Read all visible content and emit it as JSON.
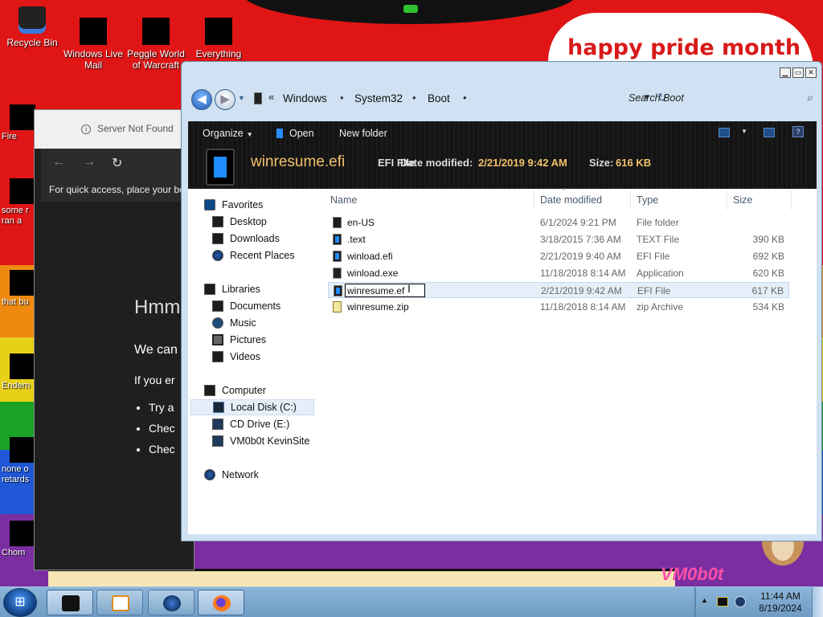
{
  "wallpaper": {
    "banner_text": "happy pride month",
    "corner_text": "VM0b0t"
  },
  "desktop_icons": [
    {
      "label": "Recycle Bin",
      "icon": "recycle-bin-icon"
    },
    {
      "label": "Windows Live Mail",
      "icon": "mail-icon"
    },
    {
      "label": "Peggle World of Warcraft",
      "icon": "game-icon"
    },
    {
      "label": "Everything",
      "icon": "search-icon"
    }
  ],
  "side_tiles": [
    {
      "label": "Fire",
      "icon": "firefox-icon"
    },
    {
      "label": "some r ran a",
      "icon": "app-icon"
    },
    {
      "label": "that bu",
      "icon": "app-icon"
    },
    {
      "label": "Endern",
      "icon": "app-icon"
    },
    {
      "label": "none o retards",
      "icon": "app-icon"
    },
    {
      "label": "Chom",
      "icon": "app-icon"
    }
  ],
  "browser": {
    "tab_text": "Server Not Found",
    "quick_access": "For quick access, place your bo",
    "heading": "Hmm",
    "line1": "We can",
    "line2": "If you er",
    "bullets": [
      "Try a",
      "Chec",
      "Chec"
    ]
  },
  "explorer": {
    "breadcrumb": [
      "Windows",
      "System32",
      "Boot"
    ],
    "search_placeholder": "Search Boot",
    "toolbar": {
      "organize": "Organize",
      "open": "Open",
      "new_folder": "New folder"
    },
    "details": {
      "name": "winresume.efi",
      "type": "EFI File",
      "modified_label": "Date modified:",
      "modified_value": "2/21/2019 9:42 AM",
      "size_label": "Size:",
      "size_value": "616 KB"
    },
    "nav": {
      "favorites": "Favorites",
      "favorites_items": [
        "Desktop",
        "Downloads",
        "Recent Places"
      ],
      "libraries": "Libraries",
      "libraries_items": [
        "Documents",
        "Music",
        "Pictures",
        "Videos"
      ],
      "computer": "Computer",
      "computer_items": [
        "Local Disk (C:)",
        "CD Drive (E:)",
        "VM0b0t KevinSite"
      ],
      "network": "Network"
    },
    "columns": [
      "Name",
      "Date modified",
      "Type",
      "Size"
    ],
    "files": [
      {
        "name": "en-US",
        "date": "6/1/2024 9:21 PM",
        "type": "File folder",
        "size": ""
      },
      {
        "name": ".text",
        "date": "3/18/2015 7:36 AM",
        "type": "TEXT File",
        "size": "390 KB"
      },
      {
        "name": "winload.efi",
        "date": "2/21/2019 9:40 AM",
        "type": "EFI File",
        "size": "692 KB"
      },
      {
        "name": "winload.exe",
        "date": "11/18/2018 8:14 AM",
        "type": "Application",
        "size": "620 KB"
      },
      {
        "name": "winresume.ef",
        "date": "2/21/2019 9:42 AM",
        "type": "EFI File",
        "size": "617 KB"
      },
      {
        "name": "winresume.zip",
        "date": "11/18/2018 8:14 AM",
        "type": "zip Archive",
        "size": "534 KB"
      }
    ],
    "rename_value": "winresume.ef"
  },
  "taskbar": {
    "apps": [
      "explorer-icon",
      "media-player-icon",
      "globe-icon",
      "firefox-icon"
    ],
    "time": "11:44 AM",
    "date": "8/19/2024"
  }
}
